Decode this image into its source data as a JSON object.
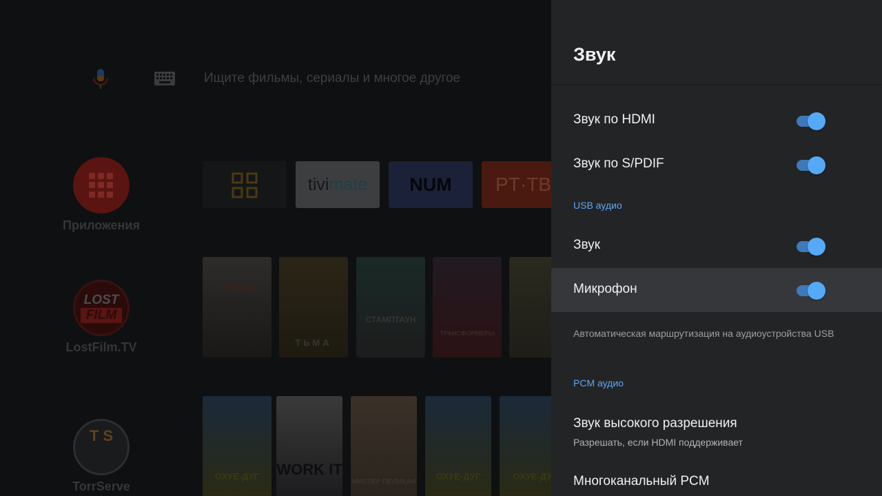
{
  "launcher": {
    "search_placeholder": "Ищите фильмы, сериалы и многое другое",
    "icons": {
      "mic": "mic-icon",
      "keyboard": "keyboard-icon"
    },
    "rail": [
      {
        "label": "Приложения",
        "icon": "apps-grid-icon"
      },
      {
        "label": "LostFilm.TV",
        "icon_text_top": "LOST",
        "icon_text_bottom": "FILM"
      },
      {
        "label": "TorrServe",
        "icon_text": "T S"
      }
    ],
    "app_tiles": [
      {
        "name": "all-apps",
        "icon": "grid-icon"
      },
      {
        "name": "tivimate",
        "text_a": "tivi",
        "text_b": "mate"
      },
      {
        "name": "num",
        "text": "NUM"
      },
      {
        "name": "rt",
        "text": "PT·TB"
      }
    ],
    "posters_row1": [
      {
        "title": "СТРАНК"
      },
      {
        "title": "ТЬМА"
      },
      {
        "title": "СТАМПТАУН"
      },
      {
        "title": "ТРАНСФОРМЕРЫ"
      },
      {
        "title": ""
      }
    ],
    "posters_row2": [
      {
        "title": "ОХУЕ-ДУГ"
      },
      {
        "title": "WORK IT"
      },
      {
        "title": "МИСТЕР ПЕЛИКАН"
      },
      {
        "title": "ОХУЕ-ДУГ"
      },
      {
        "title": "ОХУЕ-ДУ"
      }
    ]
  },
  "panel": {
    "title": "Звук",
    "items": [
      {
        "label": "Звук по HDMI",
        "toggle": true
      },
      {
        "label": "Звук по S/PDIF",
        "toggle": true
      }
    ],
    "usb_section": {
      "header": "USB аудио",
      "items": [
        {
          "label": "Звук",
          "toggle": true
        },
        {
          "label": "Микрофон",
          "toggle": true
        }
      ],
      "hint": "Автоматическая маршрутизация на аудиоустройства USB"
    },
    "pcm_section": {
      "header": "PCM аудио",
      "items": [
        {
          "label": "Звук высокого разрешения",
          "sublabel": "Разрешать, если HDMI поддерживает"
        },
        {
          "label": "Многоканальный PCM"
        }
      ]
    },
    "colors": {
      "accent": "#5fa8f5",
      "toggle_thumb": "#55a9f7",
      "toggle_track": "#3e79b9",
      "panel_bg": "#232426",
      "focus_bg": "#36373a"
    }
  }
}
